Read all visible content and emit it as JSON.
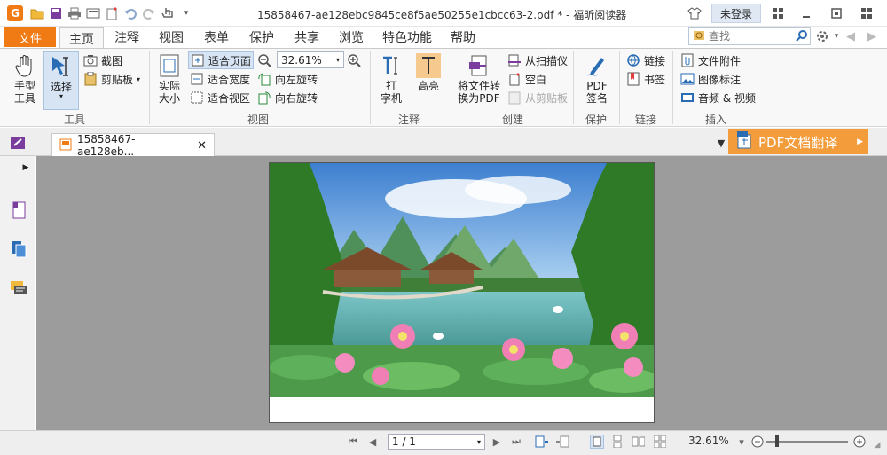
{
  "window": {
    "title": "15858467-ae128ebc9845ce8f5ae50255e1cbcc63-2.pdf * - 福昕阅读器",
    "login_label": "未登录"
  },
  "ribbon_tabs": {
    "file": "文件",
    "tabs": [
      "主页",
      "注释",
      "视图",
      "表单",
      "保护",
      "共享",
      "浏览",
      "特色功能",
      "帮助"
    ],
    "active": "主页"
  },
  "search": {
    "placeholder": "查找"
  },
  "ribbon": {
    "tools": {
      "hand": "手型\n工具",
      "select": "选择",
      "snapshot": "截图",
      "clipboard": "剪贴板",
      "group": "工具"
    },
    "view": {
      "actual_size": "实际\n大小",
      "fit_page": "适合页面",
      "fit_width": "适合宽度",
      "fit_visible": "适合视区",
      "zoom": "32.61%",
      "rotate_left": "向左旋转",
      "rotate_right": "向右旋转",
      "group": "视图"
    },
    "comment": {
      "typewriter": "打\n字机",
      "highlight": "高亮",
      "group": "注释"
    },
    "create": {
      "convert": "将文件转\n换为PDF",
      "from_scanner": "从扫描仪",
      "blank": "空白",
      "from_clipboard": "从剪贴板",
      "group": "创建"
    },
    "protect": {
      "pdf_sign": "PDF\n签名",
      "group": "保护"
    },
    "links": {
      "link": "链接",
      "bookmark": "书签",
      "group": "链接"
    },
    "insert": {
      "attachment": "文件附件",
      "image_annotation": "图像标注",
      "audio_video": "音频 & 视频",
      "group": "插入"
    }
  },
  "document_tab": {
    "name": "15858467-ae128eb..."
  },
  "translate_button": {
    "label": "PDF文档翻译"
  },
  "statusbar": {
    "page": "1 / 1",
    "zoom": "32.61%"
  },
  "colors": {
    "accent": "#f07b14",
    "translate": "#f39c3c",
    "viewport": "#9c9c9c"
  }
}
